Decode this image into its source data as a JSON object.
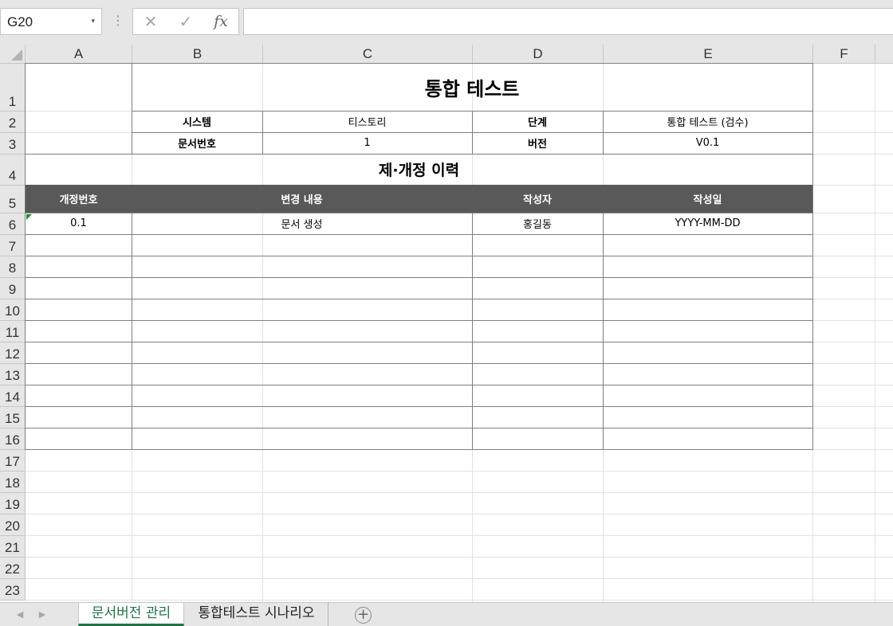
{
  "formula_bar": {
    "name_box": "G20",
    "name_box_arrow": "▾",
    "dots": "⋮",
    "cancel_icon": "✕",
    "enter_icon": "✓",
    "fx_label": "fx",
    "formula_value": ""
  },
  "columns": [
    "A",
    "B",
    "C",
    "D",
    "E",
    "F"
  ],
  "rows": [
    "1",
    "2",
    "3",
    "4",
    "5",
    "6",
    "7",
    "8",
    "9",
    "10",
    "11",
    "12",
    "13",
    "14",
    "15",
    "16",
    "17",
    "18",
    "19",
    "20",
    "21",
    "22",
    "23"
  ],
  "sheet": {
    "title": "통합 테스트",
    "info": {
      "system_label": "시스템",
      "system_value": "티스토리",
      "stage_label": "단계",
      "stage_value": "통합 테스트 (검수)",
      "doc_no_label": "문서번호",
      "doc_no_value": "1",
      "version_label": "버전",
      "version_value": "V0.1"
    },
    "history_title": "제·개정 이력",
    "history_headers": [
      "개정번호",
      "변경 내용",
      "작성자",
      "작성일"
    ],
    "history_rows": [
      [
        "0.1",
        "문서 생성",
        "홍길동",
        "YYYY-MM-DD"
      ],
      [
        "",
        "",
        "",
        ""
      ],
      [
        "",
        "",
        "",
        ""
      ],
      [
        "",
        "",
        "",
        ""
      ],
      [
        "",
        "",
        "",
        ""
      ],
      [
        "",
        "",
        "",
        ""
      ],
      [
        "",
        "",
        "",
        ""
      ],
      [
        "",
        "",
        "",
        ""
      ],
      [
        "",
        "",
        "",
        ""
      ],
      [
        "",
        "",
        "",
        ""
      ],
      [
        "",
        "",
        "",
        ""
      ]
    ]
  },
  "tabs": {
    "prev_icon": "◀",
    "next_icon": "▶",
    "items": [
      "문서버전 관리",
      "통합테스트 시나리오"
    ],
    "active": "문서버전 관리",
    "add_icon": "+"
  },
  "colors": {
    "header_fill": "#595959",
    "active_tab": "#217346",
    "comment_marker": "#1e8c2d"
  }
}
